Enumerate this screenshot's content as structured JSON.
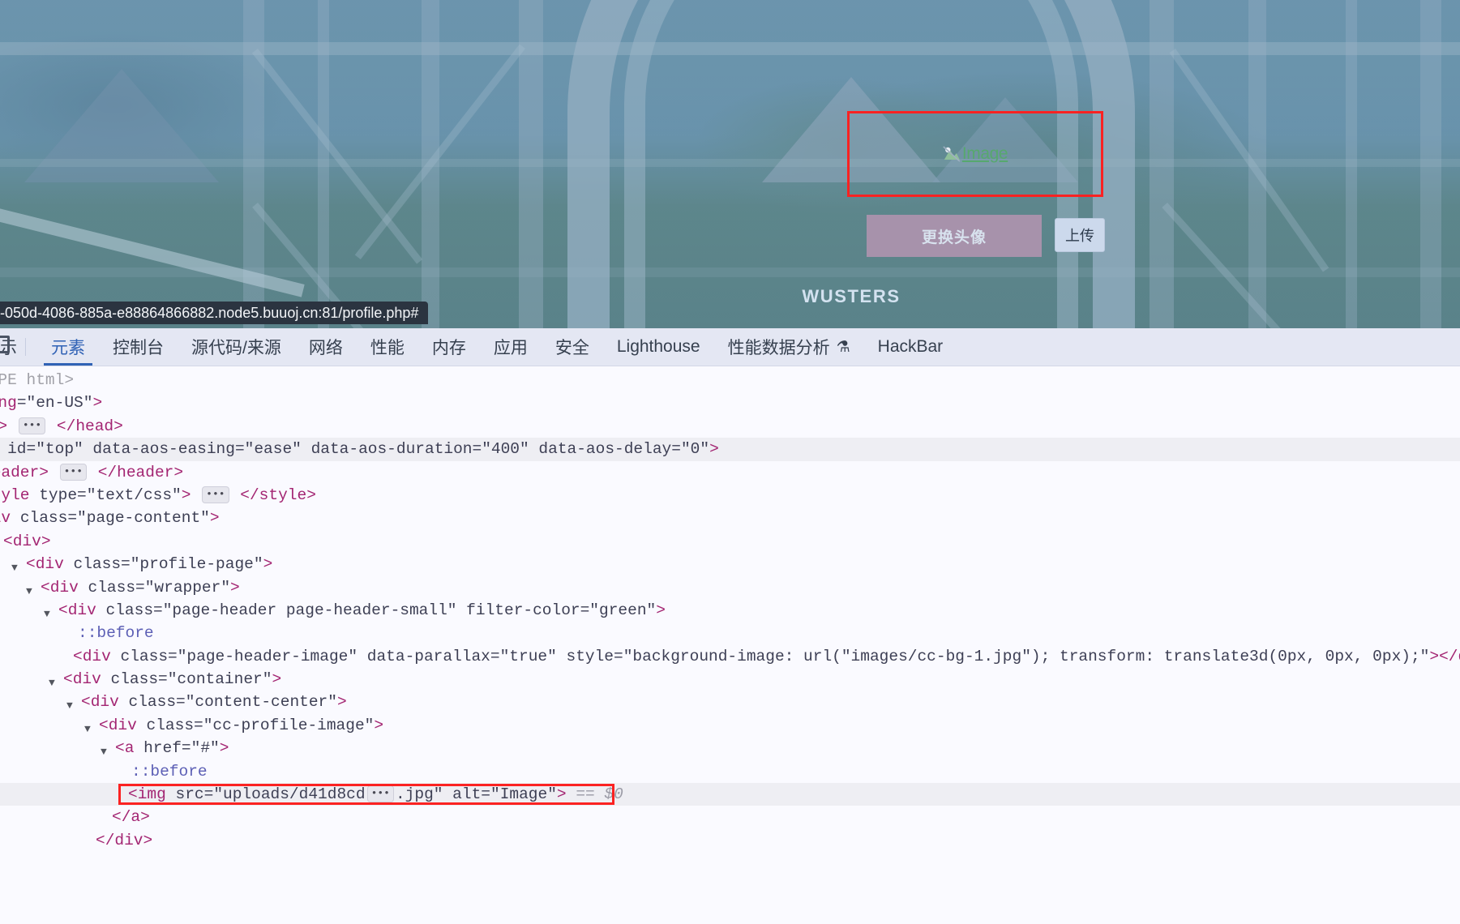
{
  "page": {
    "status_url": "-050d-4086-885a-e88864866882.node5.buuoj.cn:81/profile.php#",
    "avatar_alt_text": "Image",
    "change_avatar_label": "更换头像",
    "upload_label": "上传",
    "site_name": "WUSTERS",
    "colors": {
      "selection_red": "#fb2222",
      "change_avatar_bg": "#a792ab",
      "upload_bg": "#ccd9ec",
      "alt_text_green": "#57a86e",
      "header_filter": "green"
    }
  },
  "devtools": {
    "left_stub_label": "示",
    "tabs": [
      {
        "label": "元素",
        "active": true
      },
      {
        "label": "控制台",
        "active": false
      },
      {
        "label": "源代码/来源",
        "active": false
      },
      {
        "label": "网络",
        "active": false
      },
      {
        "label": "性能",
        "active": false
      },
      {
        "label": "内存",
        "active": false
      },
      {
        "label": "应用",
        "active": false
      },
      {
        "label": "安全",
        "active": false
      },
      {
        "label": "Lighthouse",
        "active": false
      },
      {
        "label": "性能数据分析",
        "active": false,
        "icon": "flask-icon",
        "icon_glyph": "⚗"
      },
      {
        "label": "HackBar",
        "active": false
      }
    ],
    "dom_lines": [
      {
        "text": "TYPE html>"
      },
      {
        "text": "lang=\"en-US\">"
      },
      {
        "text": "ad> ⋯ </head>"
      },
      {
        "text": "dy id=\"top\" data-aos-easing=\"ease\" data-aos-duration=\"400\" data-aos-delay=\"0\">"
      },
      {
        "text": "header> ⋯ </header>"
      },
      {
        "text": "style type=\"text/css\"> ⋯ </style>"
      },
      {
        "text": "div class=\"page-content\">"
      },
      {
        "text": "<div>"
      },
      {
        "text": "<div class=\"profile-page\">"
      },
      {
        "text": "<div class=\"wrapper\">"
      },
      {
        "text": "<div class=\"page-header page-header-small\" filter-color=\"green\">"
      },
      {
        "text": "::before"
      },
      {
        "text": "<div class=\"page-header-image\" data-parallax=\"true\" style=\"background-image: url(\"images/cc-bg-1.jpg\"); transform: translate3d(0px, 0px, 0px);\"></div>"
      },
      {
        "text": "<div class=\"container\">"
      },
      {
        "text": "<div class=\"content-center\">"
      },
      {
        "text": "<div class=\"cc-profile-image\">"
      },
      {
        "text": "<a href=\"#\">"
      },
      {
        "text": "::before"
      },
      {
        "text": "<img src=\"uploads/d41d8cd⋯.jpg\" alt=\"Image\"> == $0"
      },
      {
        "text": "</a>"
      },
      {
        "text": "</div>"
      }
    ],
    "selected_node": "<img src=\"uploads/d41d8cd⋯.jpg\" alt=\"Image\">",
    "selected_marker": "== $0",
    "img_src": "uploads/d41d8cd⋯.jpg",
    "img_alt": "Image",
    "hovered_line_text": "dy id=\"top\" data-aos-easing=\"ease\" data-aos-duration=\"400\" data-aos-delay=\"0\""
  }
}
